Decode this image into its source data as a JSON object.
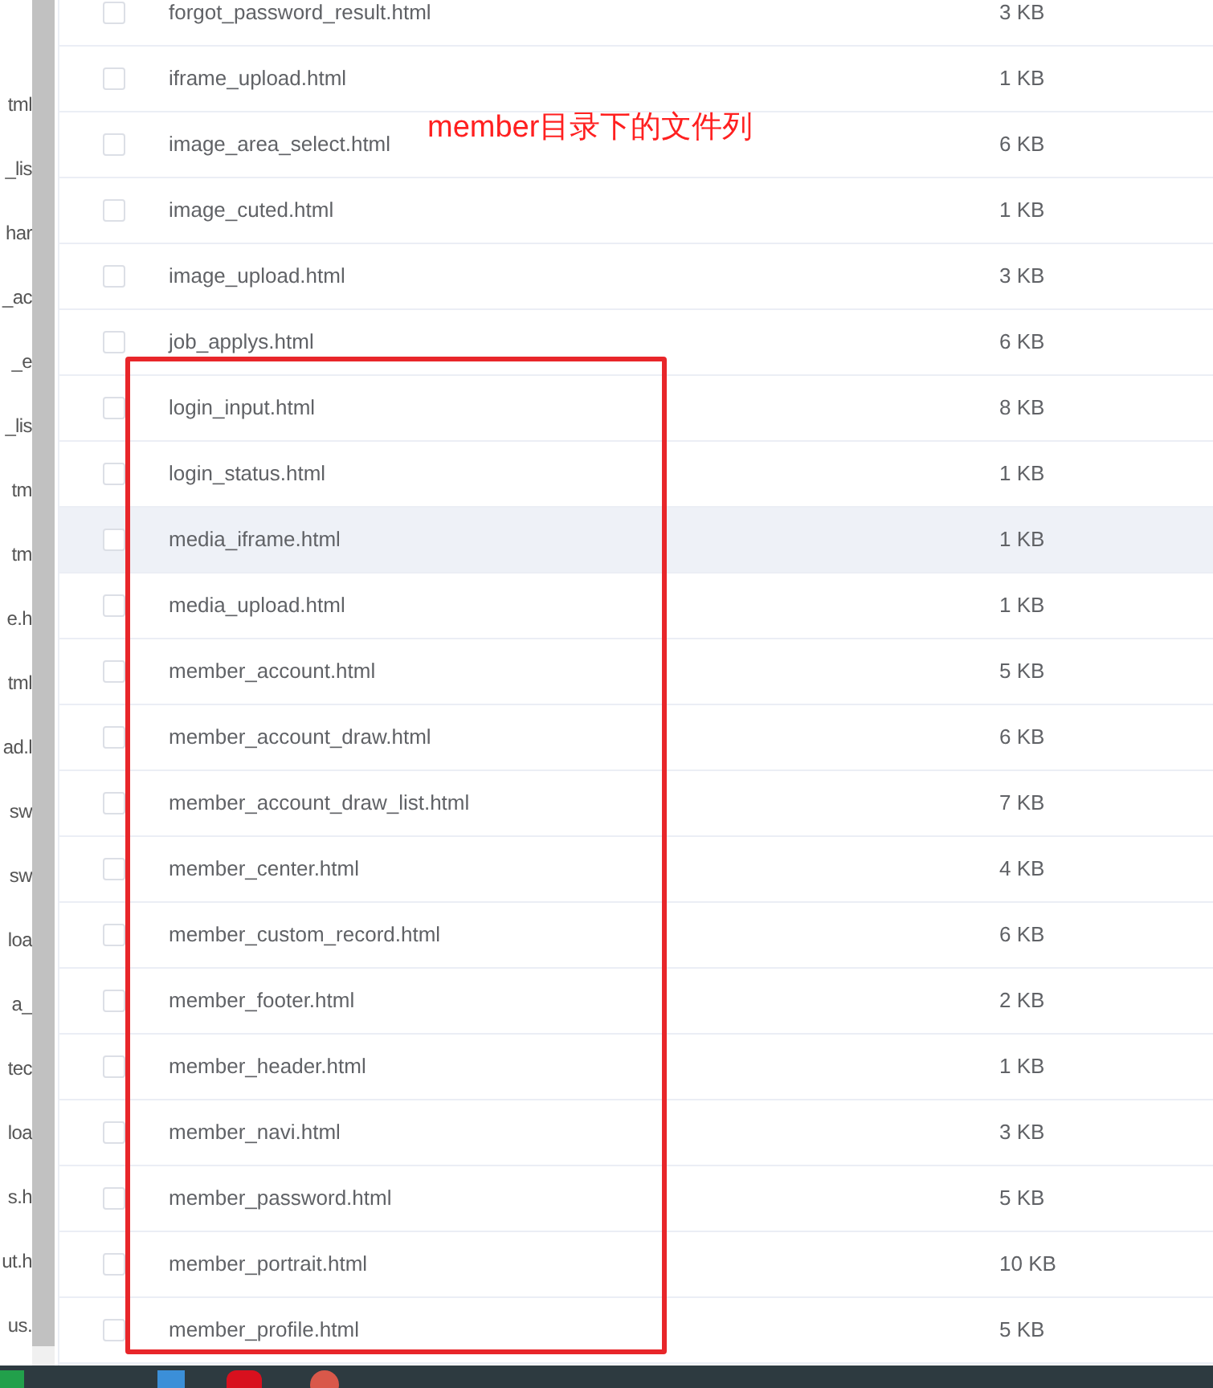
{
  "side_panel": {
    "items": [
      "tml",
      "_lis",
      "har",
      "_ac",
      "_e",
      "_lis",
      "tm",
      "tm",
      "e.h",
      "tml",
      "ad.l",
      "sw",
      "sw",
      "loa",
      "a_",
      "tec",
      "loa",
      "s.h",
      "ut.h",
      "us."
    ]
  },
  "files": [
    {
      "name": "forgot_password_result.html",
      "size": "3 KB",
      "checked": false,
      "highlighted": false
    },
    {
      "name": "iframe_upload.html",
      "size": "1 KB",
      "checked": false,
      "highlighted": false
    },
    {
      "name": "image_area_select.html",
      "size": "6 KB",
      "checked": false,
      "highlighted": false
    },
    {
      "name": "image_cuted.html",
      "size": "1 KB",
      "checked": false,
      "highlighted": false
    },
    {
      "name": "image_upload.html",
      "size": "3 KB",
      "checked": false,
      "highlighted": false
    },
    {
      "name": "job_applys.html",
      "size": "6 KB",
      "checked": false,
      "highlighted": false
    },
    {
      "name": "login_input.html",
      "size": "8 KB",
      "checked": false,
      "highlighted": false
    },
    {
      "name": "login_status.html",
      "size": "1 KB",
      "checked": false,
      "highlighted": false
    },
    {
      "name": "media_iframe.html",
      "size": "1 KB",
      "checked": false,
      "highlighted": true
    },
    {
      "name": "media_upload.html",
      "size": "1 KB",
      "checked": false,
      "highlighted": false
    },
    {
      "name": "member_account.html",
      "size": "5 KB",
      "checked": false,
      "highlighted": false
    },
    {
      "name": "member_account_draw.html",
      "size": "6 KB",
      "checked": false,
      "highlighted": false
    },
    {
      "name": "member_account_draw_list.html",
      "size": "7 KB",
      "checked": false,
      "highlighted": false
    },
    {
      "name": "member_center.html",
      "size": "4 KB",
      "checked": false,
      "highlighted": false
    },
    {
      "name": "member_custom_record.html",
      "size": "6 KB",
      "checked": false,
      "highlighted": false
    },
    {
      "name": "member_footer.html",
      "size": "2 KB",
      "checked": false,
      "highlighted": false
    },
    {
      "name": "member_header.html",
      "size": "1 KB",
      "checked": false,
      "highlighted": false
    },
    {
      "name": "member_navi.html",
      "size": "3 KB",
      "checked": false,
      "highlighted": false
    },
    {
      "name": "member_password.html",
      "size": "5 KB",
      "checked": false,
      "highlighted": false
    },
    {
      "name": "member_portrait.html",
      "size": "10 KB",
      "checked": false,
      "highlighted": false
    },
    {
      "name": "member_profile.html",
      "size": "5 KB",
      "checked": false,
      "highlighted": false
    }
  ],
  "annotation": {
    "text": "member目录下的文件列"
  }
}
